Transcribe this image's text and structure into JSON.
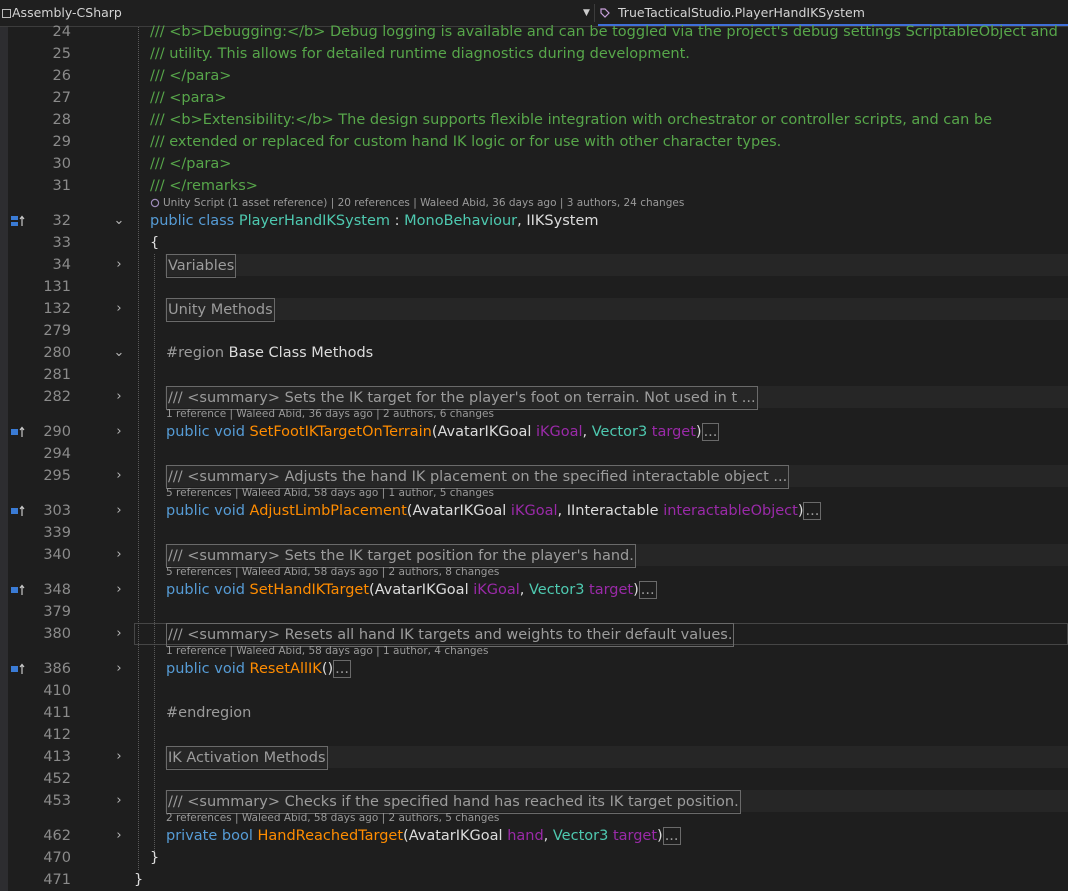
{
  "topbar": {
    "project": "Assembly-CSharp",
    "class_path": "TrueTacticalStudio.PlayerHandIKSystem"
  },
  "lines": {
    "l24": {
      "num": "24",
      "text": "/// <b>Debugging:</b> Debug logging is available and can be toggled via the project's debug settings ScriptableObject and"
    },
    "l25": {
      "num": "25",
      "text": "/// utility. This allows for detailed runtime diagnostics during development."
    },
    "l26": {
      "num": "26",
      "text": "/// </para>"
    },
    "l27": {
      "num": "27",
      "text": "/// <para>"
    },
    "l28": {
      "num": "28",
      "text": "/// <b>Extensibility:</b> The design supports flexible integration with orchestrator or controller scripts, and can be"
    },
    "l29": {
      "num": "29",
      "text": "/// extended or replaced for custom hand IK logic or for use with other character types."
    },
    "l30": {
      "num": "30",
      "text": "/// </para>"
    },
    "l31": {
      "num": "31",
      "text": "/// </remarks>"
    },
    "lens32": "Unity Script (1 asset reference) | 20 references | Waleed Abid, 36 days ago | 3 authors, 24 changes",
    "l32": {
      "num": "32",
      "kw": "public class ",
      "name": "PlayerHandIKSystem",
      "sep": " : ",
      "base1": "MonoBehaviour",
      "comma": ", ",
      "base2": "IIKSystem"
    },
    "l33": {
      "num": "33",
      "text": "{"
    },
    "l34": {
      "num": "34",
      "text": "Variables"
    },
    "l131": {
      "num": "131"
    },
    "l132": {
      "num": "132",
      "text": "Unity Methods"
    },
    "l279": {
      "num": "279"
    },
    "l280": {
      "num": "280",
      "directive": "#region ",
      "name": "Base Class Methods"
    },
    "l281": {
      "num": "281"
    },
    "l282": {
      "num": "282",
      "text": "/// <summary> Sets the IK target for the player's foot on terrain. Not used in t ..."
    },
    "lens290": "1 reference | Waleed Abid, 36 days ago | 2 authors, 6 changes",
    "l290": {
      "num": "290",
      "kw": "public void ",
      "name": "SetFootIKTargetOnTerrain",
      "open": "(",
      "t1": "AvatarIKGoal",
      "p1": "iKGoal",
      "c": ", ",
      "t2": "Vector3",
      "p2": "target",
      "close": ")",
      "ell": "..."
    },
    "l294": {
      "num": "294"
    },
    "l295": {
      "num": "295",
      "text": "/// <summary> Adjusts the hand IK placement on the specified interactable object ..."
    },
    "lens303": "5 references | Waleed Abid, 58 days ago | 1 author, 5 changes",
    "l303": {
      "num": "303",
      "kw": "public void ",
      "name": "AdjustLimbPlacement",
      "open": "(",
      "t1": "AvatarIKGoal",
      "p1": "iKGoal",
      "c": ", ",
      "t2": "IInteractable",
      "p2": "interactableObject",
      "close": ")",
      "ell": "..."
    },
    "l339": {
      "num": "339"
    },
    "l340": {
      "num": "340",
      "text": "/// <summary> Sets the IK target position for the player's hand."
    },
    "lens348": "5 references | Waleed Abid, 58 days ago | 2 authors, 8 changes",
    "l348": {
      "num": "348",
      "kw": "public void ",
      "name": "SetHandIKTarget",
      "open": "(",
      "t1": "AvatarIKGoal",
      "p1": "iKGoal",
      "c": ", ",
      "t2": "Vector3",
      "p2": "target",
      "close": ")",
      "ell": "..."
    },
    "l379": {
      "num": "379"
    },
    "l380": {
      "num": "380",
      "text": "/// <summary> Resets all hand IK targets and weights to their default values."
    },
    "lens386": "1 reference | Waleed Abid, 58 days ago | 1 author, 4 changes",
    "l386": {
      "num": "386",
      "kw": "public void ",
      "name": "ResetAllIK",
      "parens": "()",
      "ell": "..."
    },
    "l410": {
      "num": "410"
    },
    "l411": {
      "num": "411",
      "text": "#endregion"
    },
    "l412": {
      "num": "412"
    },
    "l413": {
      "num": "413",
      "text": "IK Activation Methods"
    },
    "l452": {
      "num": "452"
    },
    "l453": {
      "num": "453",
      "text": "/// <summary> Checks if the specified hand has reached its IK target position."
    },
    "lens462": "2 references | Waleed Abid, 58 days ago | 2 authors, 5 changes",
    "l462": {
      "num": "462",
      "kw": "private bool ",
      "name": "HandReachedTarget",
      "open": "(",
      "t1": "AvatarIKGoal",
      "p1": "hand",
      "c": ", ",
      "t2": "Vector3",
      "p2": "target",
      "close": ")",
      "ell": "..."
    },
    "l470": {
      "num": "470",
      "text": "}"
    },
    "l471": {
      "num": "471",
      "text": "}"
    }
  },
  "icons": {
    "fold_closed": "chevron-right-icon",
    "fold_open": "chevron-down-icon",
    "override": "override-marker-icon",
    "unity": "unity-script-icon",
    "class": "class-icon"
  },
  "colors": {
    "comment": "#57a64a",
    "keyword": "#569cd6",
    "type": "#4ec9b0",
    "method": "#ff8c00",
    "parameter": "#9a2aa8",
    "background": "#1e1e1e"
  }
}
